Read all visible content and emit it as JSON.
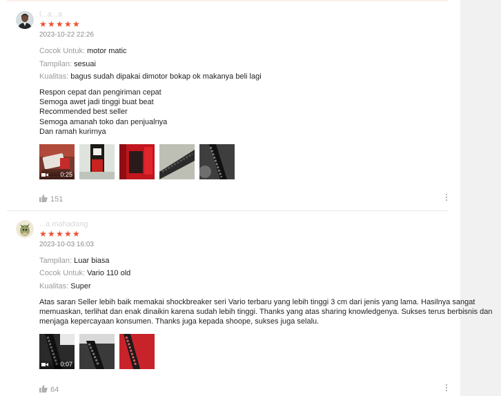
{
  "reviews": [
    {
      "username": "l...a...a",
      "rating": 5,
      "date": "2023-10-22 22:26",
      "attributes": [
        {
          "key": "Cocok Untuk:",
          "value": "motor matic"
        },
        {
          "key": "Tampilan:",
          "value": "sesuai"
        },
        {
          "key": "Kualitas:",
          "value": "bagus sudah dipakai dimotor bokap ok makanya beli lagi"
        }
      ],
      "body_lines": [
        "Respon cepat dan pengiriman cepat",
        "Semoga awet jadi tinggi buat beat",
        "Recommended best seller",
        "Semoga amanah toko dan penjualnya",
        "Dan ramah kurirnya"
      ],
      "video_duration": "0:25",
      "likes": "151"
    },
    {
      "username": "...a mahadang",
      "rating": 5,
      "date": "2023-10-03 16:03",
      "attributes": [
        {
          "key": "Tampilan:",
          "value": "Luar biasa"
        },
        {
          "key": "Cocok Untuk:",
          "value": "Vario 110 old"
        },
        {
          "key": "Kualitas:",
          "value": "Super"
        }
      ],
      "body_lines": [
        "Atas saran Seller lebih baik memakai shockbreaker seri Vario terbaru yang lebih tinggi 3 cm dari jenis yang lama. Hasilnya sangat",
        "memuaskan, terlihat dan enak dinaikin karena sudah lebih tinggi. Thanks yang atas sharing knowledgenya. Sukses terus berbisnis dan",
        "menjaga kepercayaan konsumen. Thanks juga kepada shoope, sukses juga selalu."
      ],
      "video_duration": "0:07",
      "likes": "64"
    }
  ],
  "colors": {
    "star": "#ee4d2d",
    "muted": "#9a9a9a"
  },
  "icons": {
    "like": "thumbs-up-icon",
    "more": "more-vertical-icon",
    "video": "video-camera-icon"
  }
}
